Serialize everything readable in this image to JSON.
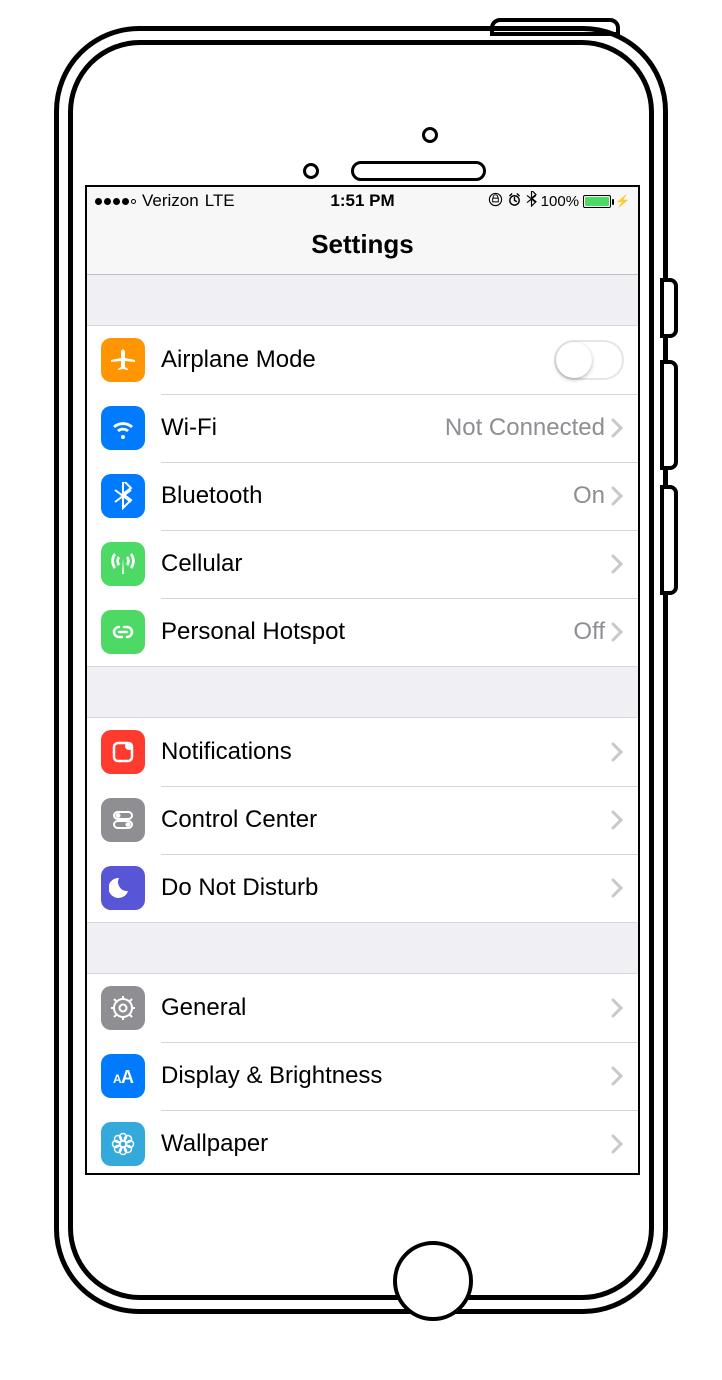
{
  "status_bar": {
    "carrier": "Verizon",
    "network": "LTE",
    "time": "1:51 PM",
    "battery_pct": "100%",
    "signal_dots_filled": 4,
    "signal_dots_total": 5,
    "icons": [
      "orientation-lock",
      "alarm",
      "bluetooth"
    ],
    "charging_glyph": "⚡"
  },
  "nav": {
    "title": "Settings"
  },
  "groups": [
    {
      "items": [
        {
          "id": "airplane-mode",
          "label": "Airplane Mode",
          "icon": "airplane-icon",
          "icon_bg": "bg-orange",
          "control": "switch",
          "switch_on": false
        },
        {
          "id": "wifi",
          "label": "Wi-Fi",
          "icon": "wifi-icon",
          "icon_bg": "bg-blue",
          "value": "Not Connected",
          "control": "disclosure"
        },
        {
          "id": "bluetooth",
          "label": "Bluetooth",
          "icon": "bluetooth-icon",
          "icon_bg": "bg-blue",
          "value": "On",
          "control": "disclosure"
        },
        {
          "id": "cellular",
          "label": "Cellular",
          "icon": "cellular-icon",
          "icon_bg": "bg-green",
          "control": "disclosure"
        },
        {
          "id": "personal-hotspot",
          "label": "Personal Hotspot",
          "icon": "hotspot-icon",
          "icon_bg": "bg-green",
          "value": "Off",
          "control": "disclosure"
        }
      ]
    },
    {
      "items": [
        {
          "id": "notifications",
          "label": "Notifications",
          "icon": "notifications-icon",
          "icon_bg": "bg-red",
          "control": "disclosure"
        },
        {
          "id": "control-center",
          "label": "Control Center",
          "icon": "control-center-icon",
          "icon_bg": "bg-gray",
          "control": "disclosure"
        },
        {
          "id": "do-not-disturb",
          "label": "Do Not Disturb",
          "icon": "moon-icon",
          "icon_bg": "bg-purple",
          "control": "disclosure"
        }
      ]
    },
    {
      "items": [
        {
          "id": "general",
          "label": "General",
          "icon": "gear-icon",
          "icon_bg": "bg-gray",
          "control": "disclosure"
        },
        {
          "id": "display-brightness",
          "label": "Display & Brightness",
          "icon": "text-size-icon",
          "icon_bg": "bg-blue",
          "control": "disclosure"
        },
        {
          "id": "wallpaper",
          "label": "Wallpaper",
          "icon": "flower-icon",
          "icon_bg": "bg-cyan",
          "control": "disclosure"
        }
      ]
    }
  ]
}
